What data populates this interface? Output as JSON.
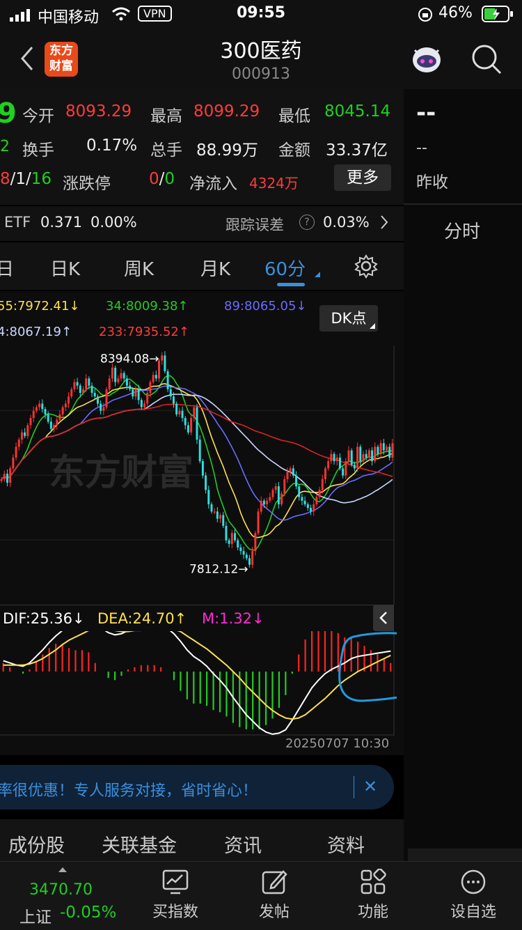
{
  "status": {
    "carrier": "中国移动",
    "vpn": "VPN",
    "time": "09:55",
    "battery": "46%"
  },
  "header": {
    "title": "300医药",
    "code": "000913",
    "logo_line1": "东方",
    "logo_line2": "财富"
  },
  "quote": {
    "open_label": "今开",
    "open": "8093.29",
    "high_label": "最高",
    "high": "8099.29",
    "low_label": "最低",
    "low": "8045.14",
    "turnover_label": "换手",
    "turnover": "0.17%",
    "volume_label": "总手",
    "volume": "88.99万",
    "amount_label": "金额",
    "amount": "33.37亿",
    "updown_part1": "8",
    "updown_part2": "/1/",
    "updown_part3": "16",
    "limit_label": "涨跌停",
    "limit_up": "0",
    "limit_sep": "/",
    "limit_down": "0",
    "netinflow_label": "净流入",
    "netinflow": "4324万",
    "more_button": "更多",
    "left_big": "9",
    "left_small": "2"
  },
  "right": {
    "dash_big": "--",
    "dash_small": "--",
    "prev_close_label": "昨收",
    "tab_intraday": "分时"
  },
  "etf": {
    "label": "ETF",
    "value": "0.371",
    "pct": "0.00%",
    "tracking_label": "跟踪误差",
    "tracking": "0.03%"
  },
  "tabs": {
    "t0": "日",
    "t1": "日K",
    "t2": "周K",
    "t3": "月K",
    "t4": "60分"
  },
  "ma": {
    "ma55": "55:7972.41↓",
    "ma34": "34:8009.38↑",
    "ma89": "89:8065.05↓",
    "ma144": "4:8067.19↑",
    "ma233": "233:7935.52↑",
    "dk_button": "DK点"
  },
  "macd": {
    "dif": "DIF:25.36↓",
    "dea": "DEA:24.70↑",
    "m": "M:1.32↓",
    "timestamp": "20250707 10:30"
  },
  "chart_data": {
    "type": "candlestick",
    "max_label": "8394.08",
    "min_label": "7812.12",
    "ylim": [
      7790,
      8410
    ],
    "colors": {
      "up": "#ff3333",
      "down": "#2fe0e0",
      "ma5": "#ffffff",
      "ma34": "#22cc22",
      "ma55": "#ffe14d",
      "ma89": "#6a6cff",
      "ma144": "#c8d8ff",
      "ma233": "#dd2222"
    },
    "closes": [
      8050,
      8065,
      8040,
      8080,
      8110,
      8140,
      8160,
      8180,
      8170,
      8200,
      8220,
      8240,
      8250,
      8260,
      8245,
      8230,
      8210,
      8190,
      8200,
      8215,
      8230,
      8250,
      8260,
      8280,
      8300,
      8320,
      8310,
      8290,
      8300,
      8330,
      8310,
      8290,
      8280,
      8260,
      8240,
      8250,
      8300,
      8330,
      8360,
      8320,
      8330,
      8345,
      8330,
      8310,
      8300,
      8280,
      8300,
      8270,
      8250,
      8260,
      8290,
      8320,
      8340,
      8330,
      8380,
      8394,
      8350,
      8300,
      8280,
      8260,
      8230,
      8240,
      8220,
      8200,
      8180,
      8220,
      8250,
      8160,
      8100,
      8060,
      8020,
      7980,
      7960,
      7960,
      7940,
      7950,
      7920,
      7880,
      7870,
      7900,
      7880,
      7860,
      7850,
      7840,
      7830,
      7812,
      7850,
      7900,
      7960,
      7990,
      7980,
      7990,
      8000,
      8020,
      8030,
      7980,
      8010,
      8050,
      8070,
      8080,
      8060,
      8030,
      8000,
      7990,
      7980,
      7970,
      7960,
      7980,
      8000,
      8020,
      8050,
      8080,
      8100,
      8120,
      8100,
      8110,
      8080,
      8060,
      8100,
      8130,
      8090,
      8080,
      8140,
      8100,
      8120,
      8110,
      8130,
      8100,
      8140,
      8120,
      8150,
      8130,
      8140,
      8110,
      8150
    ],
    "ma5": "",
    "macd_dif": [
      10,
      8,
      6,
      5,
      8,
      14,
      20,
      27,
      33,
      38,
      40,
      42,
      45,
      47,
      44,
      40,
      36,
      34,
      35,
      38,
      40,
      41,
      42,
      43,
      42,
      40,
      35,
      28,
      20,
      14,
      10,
      5,
      -2,
      -8,
      -15,
      -24,
      -32,
      -40,
      -46,
      -52,
      -56,
      -58,
      -57,
      -54,
      -45,
      -35,
      -25,
      -15,
      -8,
      -2,
      2,
      5,
      8,
      12,
      14,
      15,
      16,
      17,
      18,
      19
    ],
    "macd_dea": [
      6,
      6,
      6,
      6,
      7,
      9,
      12,
      16,
      20,
      25,
      29,
      32,
      35,
      38,
      40,
      40,
      39,
      38,
      37,
      37,
      38,
      38,
      39,
      40,
      40,
      40,
      39,
      37,
      33,
      29,
      25,
      21,
      16,
      11,
      6,
      0,
      -6,
      -13,
      -19,
      -25,
      -31,
      -36,
      -40,
      -43,
      -44,
      -43,
      -40,
      -35,
      -30,
      -25,
      -19,
      -13,
      -8,
      -4,
      0,
      3,
      6,
      9,
      12,
      15
    ]
  },
  "banner": {
    "text": "率很优惠！专人服务对接，省时省心！",
    "close": "✕"
  },
  "bottom_tabs": {
    "t1": "成份股",
    "t2": "关联基金",
    "t3": "资讯",
    "t4": "资料"
  },
  "nav": {
    "index_value": "3470.70",
    "index_name": "上证",
    "index_change": "-0.05%",
    "buy_index": "买指数",
    "post": "发帖",
    "function": "功能",
    "watchlist": "设自选"
  }
}
